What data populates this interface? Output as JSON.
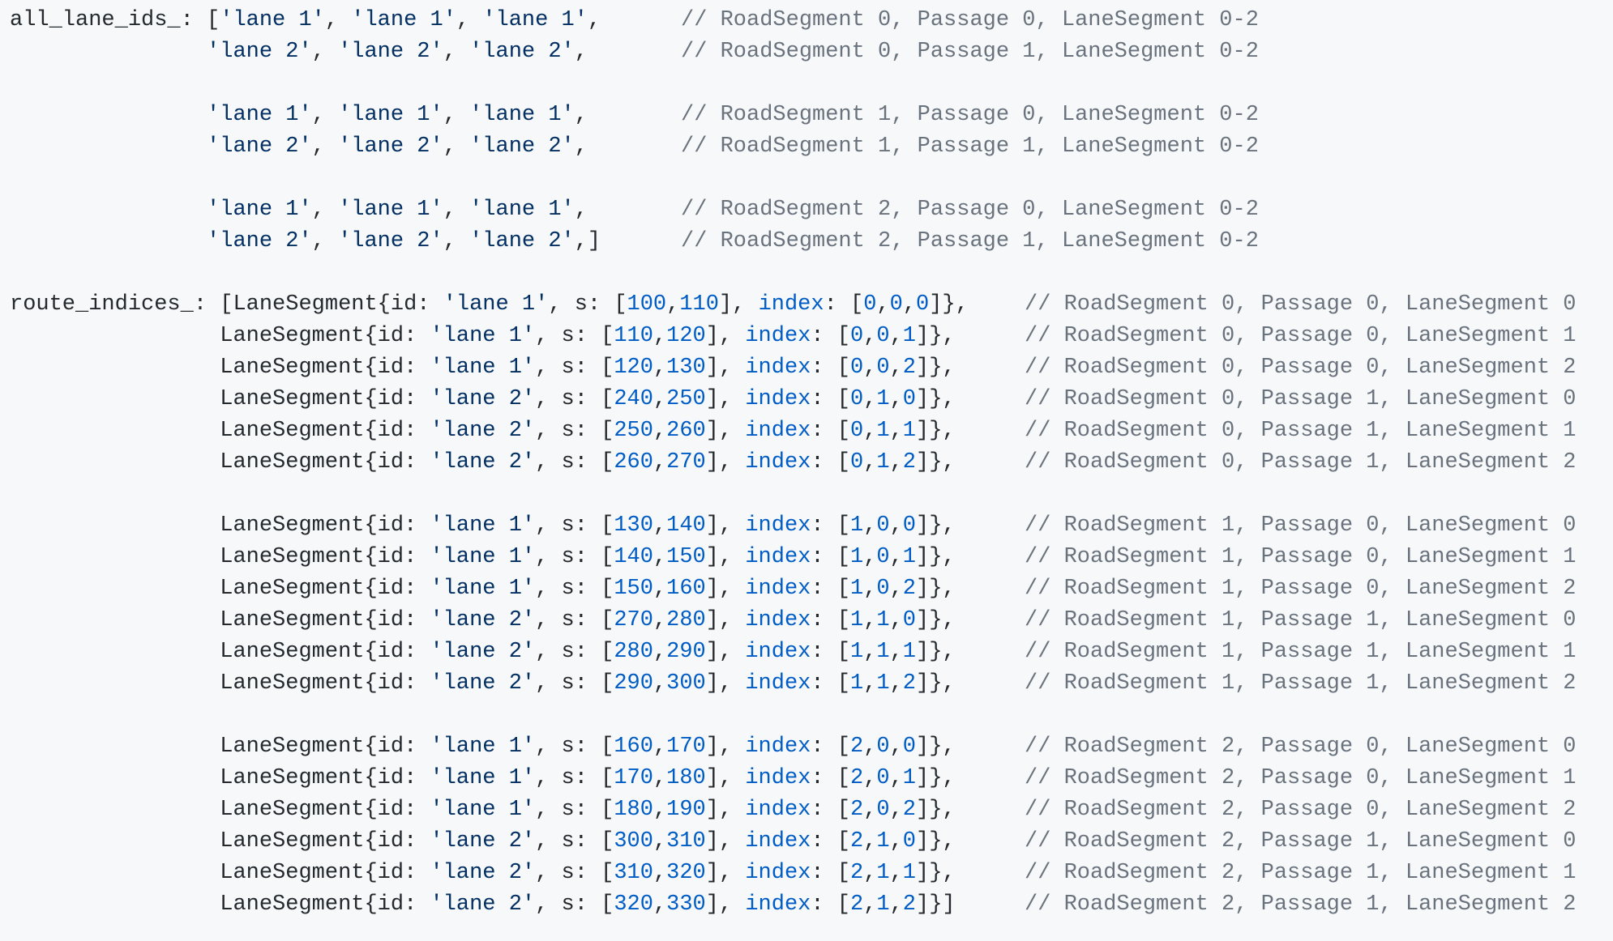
{
  "theme": {
    "background": "#f6f8fa",
    "text": "#24292e",
    "string": "#032f62",
    "number": "#005cc5",
    "keyword": "#005cc5",
    "comment": "#6a737d"
  },
  "code": {
    "lines": [
      {
        "text": "all_lane_ids_: ['lane 1', 'lane 1', 'lane 1',",
        "comment": "// RoadSegment 0, Passage 0, LaneSegment 0-2"
      },
      {
        "text": "               'lane 2', 'lane 2', 'lane 2',",
        "comment": "// RoadSegment 0, Passage 1, LaneSegment 0-2"
      },
      {
        "text": "",
        "comment": ""
      },
      {
        "text": "               'lane 1', 'lane 1', 'lane 1',",
        "comment": "// RoadSegment 1, Passage 0, LaneSegment 0-2"
      },
      {
        "text": "               'lane 2', 'lane 2', 'lane 2',",
        "comment": "// RoadSegment 1, Passage 1, LaneSegment 0-2"
      },
      {
        "text": "",
        "comment": ""
      },
      {
        "text": "               'lane 1', 'lane 1', 'lane 1',",
        "comment": "// RoadSegment 2, Passage 0, LaneSegment 0-2"
      },
      {
        "text": "               'lane 2', 'lane 2', 'lane 2',]",
        "comment": "// RoadSegment 2, Passage 1, LaneSegment 0-2"
      },
      {
        "text": "",
        "comment": ""
      },
      {
        "text": "route_indices_: [LaneSegment{id: 'lane 1', s: [100,110], index: [0,0,0]},",
        "comment": "// RoadSegment 0, Passage 0, LaneSegment 0"
      },
      {
        "text": "                LaneSegment{id: 'lane 1', s: [110,120], index: [0,0,1]},",
        "comment": "// RoadSegment 0, Passage 0, LaneSegment 1"
      },
      {
        "text": "                LaneSegment{id: 'lane 1', s: [120,130], index: [0,0,2]},",
        "comment": "// RoadSegment 0, Passage 0, LaneSegment 2"
      },
      {
        "text": "                LaneSegment{id: 'lane 2', s: [240,250], index: [0,1,0]},",
        "comment": "// RoadSegment 0, Passage 1, LaneSegment 0"
      },
      {
        "text": "                LaneSegment{id: 'lane 2', s: [250,260], index: [0,1,1]},",
        "comment": "// RoadSegment 0, Passage 1, LaneSegment 1"
      },
      {
        "text": "                LaneSegment{id: 'lane 2', s: [260,270], index: [0,1,2]},",
        "comment": "// RoadSegment 0, Passage 1, LaneSegment 2"
      },
      {
        "text": "",
        "comment": ""
      },
      {
        "text": "                LaneSegment{id: 'lane 1', s: [130,140], index: [1,0,0]},",
        "comment": "// RoadSegment 1, Passage 0, LaneSegment 0"
      },
      {
        "text": "                LaneSegment{id: 'lane 1', s: [140,150], index: [1,0,1]},",
        "comment": "// RoadSegment 1, Passage 0, LaneSegment 1"
      },
      {
        "text": "                LaneSegment{id: 'lane 1', s: [150,160], index: [1,0,2]},",
        "comment": "// RoadSegment 1, Passage 0, LaneSegment 2"
      },
      {
        "text": "                LaneSegment{id: 'lane 2', s: [270,280], index: [1,1,0]},",
        "comment": "// RoadSegment 1, Passage 1, LaneSegment 0"
      },
      {
        "text": "                LaneSegment{id: 'lane 2', s: [280,290], index: [1,1,1]},",
        "comment": "// RoadSegment 1, Passage 1, LaneSegment 1"
      },
      {
        "text": "                LaneSegment{id: 'lane 2', s: [290,300], index: [1,1,2]},",
        "comment": "// RoadSegment 1, Passage 1, LaneSegment 2"
      },
      {
        "text": "",
        "comment": ""
      },
      {
        "text": "                LaneSegment{id: 'lane 1', s: [160,170], index: [2,0,0]},",
        "comment": "// RoadSegment 2, Passage 0, LaneSegment 0"
      },
      {
        "text": "                LaneSegment{id: 'lane 1', s: [170,180], index: [2,0,1]},",
        "comment": "// RoadSegment 2, Passage 0, LaneSegment 1"
      },
      {
        "text": "                LaneSegment{id: 'lane 1', s: [180,190], index: [2,0,2]},",
        "comment": "// RoadSegment 2, Passage 0, LaneSegment 2"
      },
      {
        "text": "                LaneSegment{id: 'lane 2', s: [300,310], index: [2,1,0]},",
        "comment": "// RoadSegment 2, Passage 1, LaneSegment 0"
      },
      {
        "text": "                LaneSegment{id: 'lane 2', s: [310,320], index: [2,1,1]},",
        "comment": "// RoadSegment 2, Passage 1, LaneSegment 1"
      },
      {
        "text": "                LaneSegment{id: 'lane 2', s: [320,330], index: [2,1,2]}]",
        "comment": "// RoadSegment 2, Passage 1, LaneSegment 2"
      }
    ]
  }
}
